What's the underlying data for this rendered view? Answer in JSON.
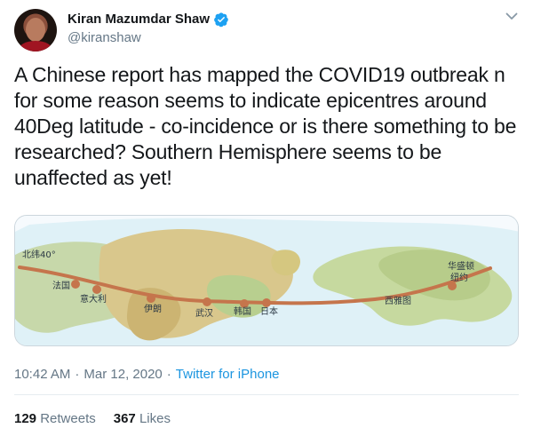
{
  "tweet": {
    "author": {
      "name": "Kiran Mazumdar Shaw",
      "handle": "@kiranshaw"
    },
    "text": "A Chinese report has mapped the COVID19 outbreak n for some reason seems to indicate epicentres around 40Deg latitude - co-incidence or is there something to be researched? Southern Hemisphere seems to be unaffected as yet!",
    "media": {
      "latitude_label": "北纬40°",
      "places": [
        "法国",
        "意大利",
        "伊朗",
        "武汉",
        "韩国",
        "日本",
        "西雅图",
        "华盛顿",
        "纽约"
      ]
    },
    "timestamp": "10:42 AM",
    "date": "Mar 12, 2020",
    "source": "Twitter for iPhone",
    "separator": "·",
    "stats": {
      "retweets_count": "129",
      "retweets_label": "Retweets",
      "likes_count": "367",
      "likes_label": "Likes"
    }
  },
  "colors": {
    "link": "#1b95e0",
    "muted": "#657786",
    "verified": "#1da1f2",
    "route": "#c5754c"
  }
}
